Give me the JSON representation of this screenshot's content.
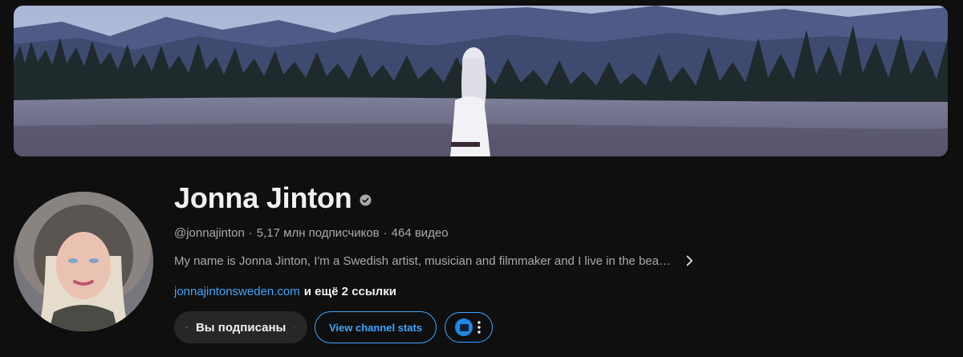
{
  "channel": {
    "name": "Jonna Jinton",
    "handle": "@jonnajinton",
    "subscribers": "5,17 млн подписчиков",
    "videos": "464 видео",
    "meta_separator": "·",
    "description": "My name is Jonna Jinton, I'm a Swedish artist, musician and filmmaker and I live in the bea…",
    "link_url": "jonnajintonsweden.com",
    "link_more": "и ещё 2 ссылки"
  },
  "actions": {
    "subscribed_label": "Вы подписаны",
    "stats_label": "View channel stats"
  },
  "icons": {
    "verified": "verified-check-icon",
    "description_expand": "chevron-right-icon",
    "bell": "bell-icon",
    "subscribe_menu": "chevron-down-icon",
    "extension": "extension-logo-icon",
    "more": "more-vert-icon"
  },
  "colors": {
    "background": "#0f0f0f",
    "link": "#3ea6ff",
    "muted_text": "#aaaaaa",
    "button_bg": "#272727"
  }
}
